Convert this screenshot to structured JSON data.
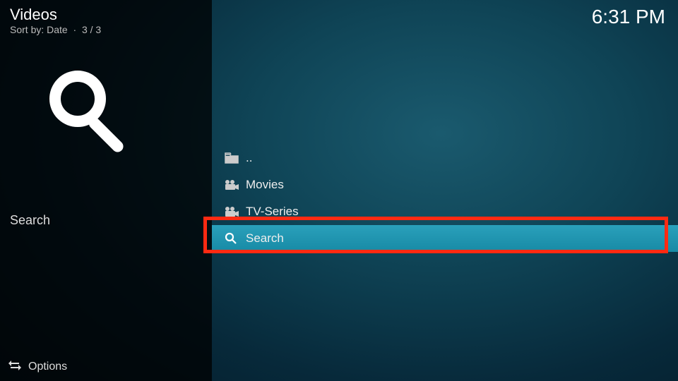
{
  "header": {
    "title": "Videos",
    "sort_label": "Sort by: Date",
    "count": "3 / 3"
  },
  "clock": "6:31 PM",
  "sidebar": {
    "selected_label": "Search",
    "options_label": "Options"
  },
  "list": {
    "items": [
      {
        "icon": "folder",
        "label": ".."
      },
      {
        "icon": "camera",
        "label": "Movies"
      },
      {
        "icon": "camera",
        "label": "TV-Series"
      },
      {
        "icon": "search",
        "label": "Search",
        "selected": true,
        "highlighted": true
      }
    ]
  }
}
